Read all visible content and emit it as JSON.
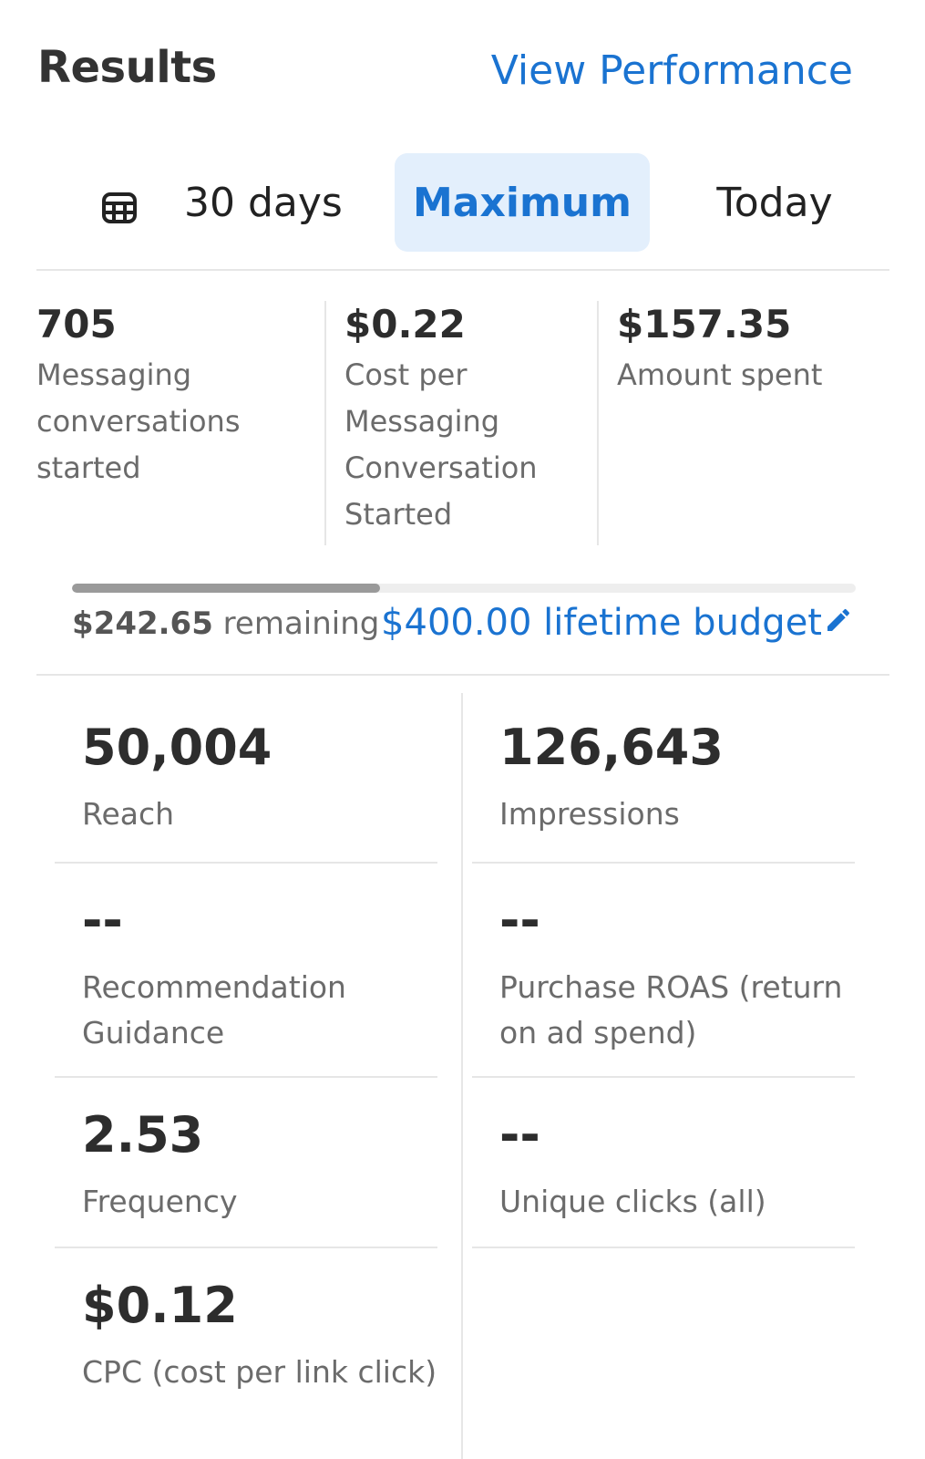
{
  "header": {
    "title": "Results",
    "view_performance": "View Performance"
  },
  "tabs": {
    "range_30": "30 days",
    "maximum": "Maximum",
    "today": "Today",
    "selected": "Maximum"
  },
  "summary": [
    {
      "value": "705",
      "label": [
        "Messaging",
        "conversations",
        "started"
      ]
    },
    {
      "value": "$0.22",
      "label": [
        "Cost per",
        "Messaging",
        "Conversation",
        "Started"
      ]
    },
    {
      "value": "$157.35",
      "label": [
        "Amount spent"
      ]
    }
  ],
  "budget": {
    "remaining_amount": "$242.65",
    "remaining_text": "remaining",
    "lifetime_budget": "$400.00 lifetime budget",
    "spent_fraction": 0.3934
  },
  "metrics": [
    {
      "value": "50,004",
      "label": "Reach"
    },
    {
      "value": "126,643",
      "label": "Impressions"
    },
    {
      "value": "--",
      "label": [
        "Recommendation",
        "Guidance"
      ]
    },
    {
      "value": "--",
      "label": [
        "Purchase ROAS (return",
        "on ad spend)"
      ]
    },
    {
      "value": "2.53",
      "label": "Frequency"
    },
    {
      "value": "--",
      "label": "Unique clicks (all)"
    },
    {
      "value": "$0.12",
      "label": "CPC (cost per link click)"
    }
  ],
  "colors": {
    "accent": "#1a73d1",
    "selected_tab_bg": "#e3effc"
  },
  "icons": {
    "calendar": "calendar-icon",
    "edit": "pencil-edit-icon"
  }
}
